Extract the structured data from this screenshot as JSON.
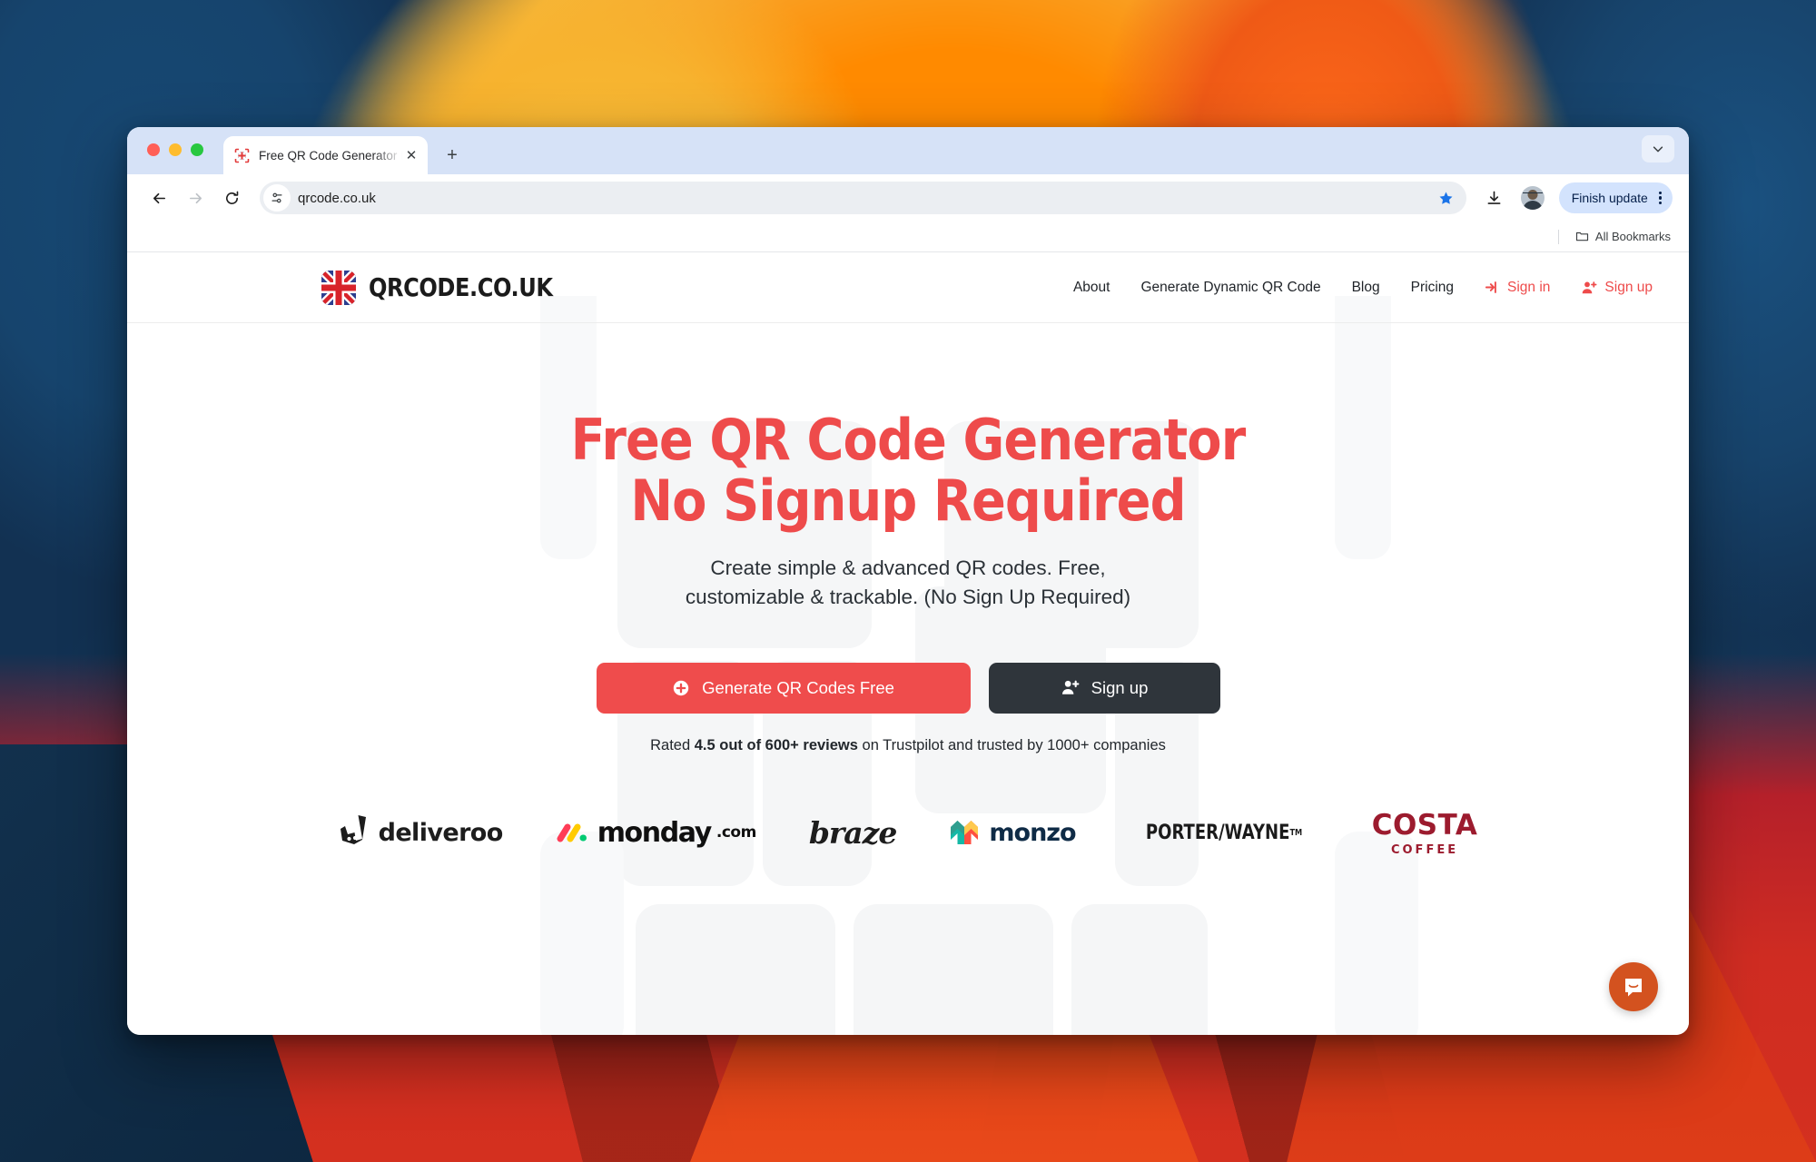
{
  "browser": {
    "tab": {
      "title": "Free QR Code Generator No S",
      "favicon_name": "qr-uk-flag-favicon",
      "close_label": "✕"
    },
    "new_tab_label": "+",
    "tab_search_icon": "chevron-down-icon",
    "toolbar": {
      "back_icon": "back-arrow-icon",
      "forward_icon": "forward-arrow-icon",
      "reload_icon": "reload-icon",
      "site_settings_icon": "tune-icon",
      "url": "qrcode.co.uk",
      "bookmark_star_icon": "star-filled-icon",
      "bookmark_star_color": "#1a73e8",
      "download_icon": "download-icon",
      "profile_icon": "profile-avatar",
      "update_label": "Finish update",
      "menu_icon": "kebab-menu-icon"
    },
    "bookmarks": {
      "folder_icon": "folder-icon",
      "all_bookmarks_label": "All Bookmarks"
    }
  },
  "site": {
    "brand": {
      "logo_icon": "uk-flag-icon",
      "name": "QRCODE.CO.UK"
    },
    "nav": [
      {
        "label": "About",
        "icon": ""
      },
      {
        "label": "Generate Dynamic QR Code",
        "icon": ""
      },
      {
        "label": "Blog",
        "icon": ""
      },
      {
        "label": "Pricing",
        "icon": ""
      }
    ],
    "account": {
      "signin_label": "Sign in",
      "signin_icon": "login-arrow-icon",
      "signup_label": "Sign up",
      "signup_icon": "user-plus-icon",
      "accent_color": "#ee4b4b"
    },
    "hero": {
      "headline_line1": "Free QR Code Generator",
      "headline_line2": "No Signup Required",
      "headline_color": "#ee4b4b",
      "subtitle_line1": "Create simple & advanced QR codes. Free,",
      "subtitle_line2": "customizable & trackable. (No Sign Up Required)",
      "primary_button": {
        "label": "Generate QR Codes Free",
        "icon": "plus-circle-icon",
        "color": "#ef4c4c"
      },
      "secondary_button": {
        "label": "Sign up",
        "icon": "user-plus-icon",
        "color": "#2f353b"
      },
      "rating": {
        "prefix": "Rated ",
        "highlight": "4.5 out of 600+ reviews",
        "suffix": " on Trustpilot and trusted by 1000+ companies"
      }
    },
    "logos": [
      {
        "name": "deliveroo",
        "label": "deliveroo"
      },
      {
        "name": "monday-com",
        "label": "monday",
        "suffix": ".com"
      },
      {
        "name": "braze",
        "label": "braze"
      },
      {
        "name": "monzo",
        "label": "monzo"
      },
      {
        "name": "porter-wayne",
        "label": "PORTER/WAYNE",
        "trademark": "TM"
      },
      {
        "name": "costa-coffee",
        "label": "COSTA",
        "sublabel": "COFFEE",
        "color": "#9c1b2e"
      }
    ],
    "chat": {
      "icon": "intercom-chat-icon",
      "color": "#d3521f"
    }
  }
}
